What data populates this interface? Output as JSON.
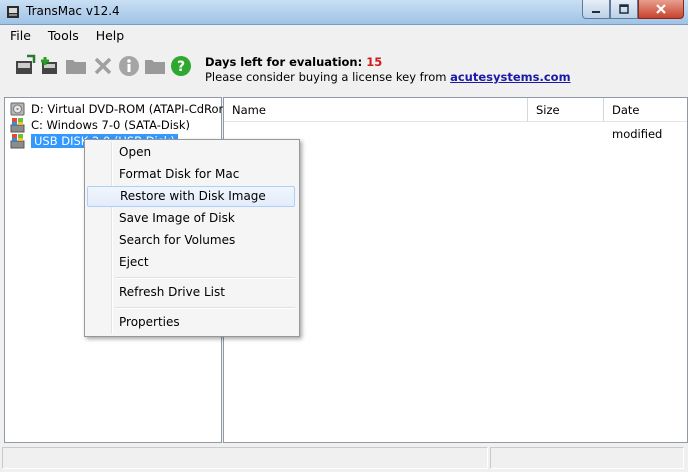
{
  "window": {
    "title": "TransMac v12.4",
    "icon": "transmac-app-icon"
  },
  "menu": [
    "File",
    "Tools",
    "Help"
  ],
  "toolbar": {
    "icons": [
      "open-disk-icon",
      "add-disk-icon",
      "folder-icon",
      "delete-icon",
      "info-icon",
      "folder-icon",
      "help-icon"
    ],
    "eval_label": "Days left for evaluation:",
    "eval_days": "15",
    "license_text": "Please consider buying a license key from",
    "license_link": "acutesystems.com"
  },
  "drives": [
    {
      "label": "D:  Virtual DVD-ROM (ATAPI-CdRom)",
      "icon": "cdrom-drive-icon"
    },
    {
      "label": "C:  Windows 7-0 (SATA-Disk)",
      "icon": "windows-drive-icon"
    },
    {
      "label": "USB DISK 2.0 (USB Disk)",
      "icon": "usb-drive-icon",
      "selected": true
    }
  ],
  "columns": [
    "Name",
    "Size",
    "Date modified"
  ],
  "context_menu": {
    "items": [
      "Open",
      "Format Disk for Mac",
      "Restore with Disk Image",
      "Save Image of Disk",
      "Search for Volumes",
      "Eject",
      "Refresh Drive List",
      "Properties"
    ],
    "highlighted": "Restore with Disk Image"
  },
  "colors": {
    "selection": "#3399ff",
    "eval_days": "#d11a1a",
    "link": "#1a1aa6"
  }
}
